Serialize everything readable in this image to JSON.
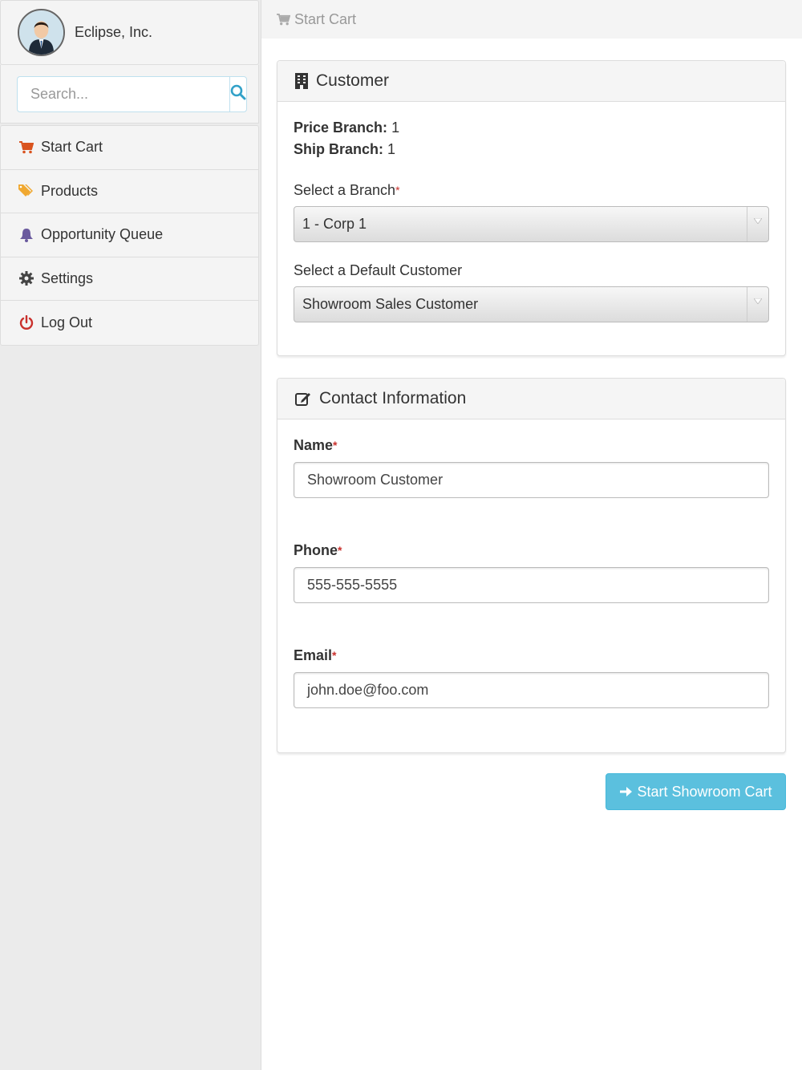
{
  "sidebar": {
    "company": "Eclipse, Inc.",
    "search": {
      "placeholder": "Search..."
    },
    "items": [
      {
        "label": "Start Cart",
        "icon": "cart-icon",
        "color": "#d9531e"
      },
      {
        "label": "Products",
        "icon": "tags-icon",
        "color": "#f0a830"
      },
      {
        "label": "Opportunity Queue",
        "icon": "bell-icon",
        "color": "#6a5a9e"
      },
      {
        "label": "Settings",
        "icon": "gear-icon",
        "color": "#444444"
      },
      {
        "label": "Log Out",
        "icon": "power-icon",
        "color": "#c9302c"
      }
    ]
  },
  "breadcrumb": {
    "label": "Start Cart",
    "icon": "cart-icon"
  },
  "customer_panel": {
    "title": "Customer",
    "price_branch_label": "Price Branch:",
    "price_branch_value": "1",
    "ship_branch_label": "Ship Branch:",
    "ship_branch_value": "1",
    "branch_label": "Select a Branch",
    "branch_required": "*",
    "branch_value": "1 - Corp 1",
    "default_customer_label": "Select a Default Customer",
    "default_customer_value": "Showroom Sales Customer"
  },
  "contact_panel": {
    "title": "Contact Information",
    "name_label": "Name",
    "name_value": "Showroom Customer",
    "phone_label": "Phone",
    "phone_value": "555-555-5555",
    "email_label": "Email",
    "email_value": "john.doe@foo.com",
    "required_mark": "*"
  },
  "actions": {
    "start_label": "Start Showroom Cart"
  },
  "colors": {
    "accent": "#5bc0de",
    "required": "#c9302c"
  }
}
